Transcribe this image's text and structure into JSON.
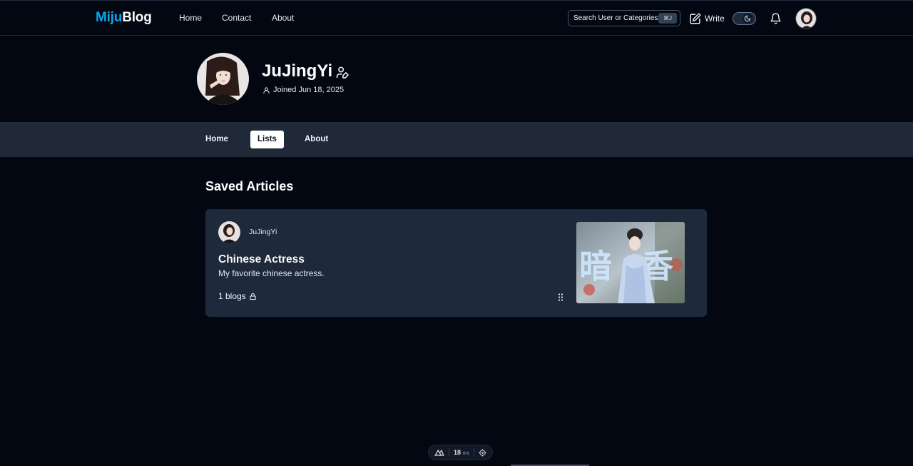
{
  "brand": {
    "part1": "Miju",
    "part2": "Blog"
  },
  "nav": {
    "home": "Home",
    "contact": "Contact",
    "about": "About"
  },
  "search": {
    "placeholder": "Search User or Categories...",
    "shortcut": "⌘J"
  },
  "write_label": "Write",
  "profile": {
    "name": "JuJingYi",
    "joined": "Joined Jun 18, 2025"
  },
  "tabs": [
    {
      "label": "Home",
      "active": false
    },
    {
      "label": "Lists",
      "active": true
    },
    {
      "label": "About",
      "active": false
    }
  ],
  "section_title": "Saved Articles",
  "list_card": {
    "author": "JuJingYi",
    "title": "Chinese Actress",
    "description": "My favorite chinese actress.",
    "count": "1 blogs",
    "thumbnail_text": "暗香"
  },
  "devtools": {
    "render_time": "18",
    "render_unit": "ms"
  },
  "colors": {
    "accent": "#0ea5e9",
    "background": "#030711",
    "card": "#1e293b",
    "tabbar": "#1f2937"
  }
}
